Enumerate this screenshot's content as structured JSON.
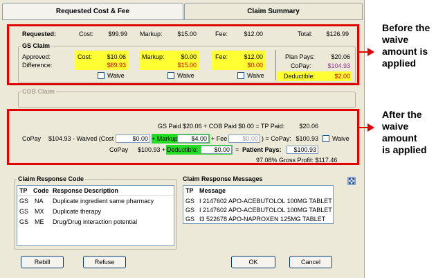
{
  "tabs": {
    "cost_fee": "Requested Cost & Fee",
    "claim_summary": "Claim Summary"
  },
  "requested": {
    "label": "Requested:",
    "cost_label": "Cost:",
    "cost": "$99.99",
    "markup_label": "Markup:",
    "markup": "$15.00",
    "fee_label": "Fee:",
    "fee": "$12.00",
    "total_label": "Total:",
    "total": "$126.99"
  },
  "gs_claim": {
    "title": "GS  Claim",
    "approved_label": "Approved:",
    "difference_label": "Difference:",
    "cost_label": "Cost:",
    "cost_approved": "$10.06",
    "cost_diff": "$89.93",
    "markup_label": "Markup:",
    "markup_approved": "$0.00",
    "markup_diff": "$15.00",
    "fee_label": "Fee:",
    "fee_approved": "$12.00",
    "fee_diff": "$0.00",
    "waive_label": "Waive",
    "plan_pays_label": "Plan Pays:",
    "plan_pays": "$20.06",
    "copay_label": "CoPay:",
    "copay": "$104.93",
    "deductible_label": "Deductible:",
    "deductible": "$2.00"
  },
  "cob_claim": {
    "title": "COB Claim"
  },
  "summary": {
    "line1": "GS Paid $20.06 + COB Paid $0.00  =  TP Paid:",
    "tp_paid": "$20.06",
    "copay_label": "CoPay",
    "copay_waived_text": "$104.93 - Waived (Cost",
    "cost_waived": "$0.00",
    "plus_markup": "+ Markup",
    "markup_waived": "$4.00",
    "plus_fee": "+ Fee",
    "fee_waived": "$0.00",
    "eq_copay": ") = CoPay:",
    "copay_after": "$100.93",
    "waive_label": "Waive",
    "copay2_label": "CoPay",
    "copay2_text": "$100.93 +",
    "deductible_label": "Deductible:",
    "deductible_value": "$0.00",
    "eq": "=",
    "patient_pays_label": "Patient Pays:",
    "patient_pays": "$100.93",
    "gross_profit": "97.08% Gross Profit: $117.46"
  },
  "response_code": {
    "title": "Claim Response Code",
    "columns": [
      "TP",
      "Code",
      "Response Description"
    ],
    "rows": [
      [
        "GS",
        "NA",
        "Duplicate ingredient same pharmacy"
      ],
      [
        "GS",
        "MX",
        "Duplicate therapy"
      ],
      [
        "GS",
        "ME",
        "Drug/Drug interaction potential"
      ]
    ]
  },
  "response_messages": {
    "title": "Claim Response Messages",
    "columns": [
      "TP",
      "Message"
    ],
    "rows": [
      [
        "GS",
        "I 2147602 APO-ACEBUTOLOL 100MG TABLET"
      ],
      [
        "GS",
        "I 2147602 APO-ACEBUTOLOL 100MG TABLET"
      ],
      [
        "GS",
        "I3 522678 APO-NAPROXEN 125MG TABLET"
      ]
    ]
  },
  "buttons": {
    "rebill": "Rebill",
    "refuse": "Refuse",
    "ok": "OK",
    "cancel": "Cancel"
  },
  "annotations": {
    "before": [
      "Before the",
      "waive",
      "amount is",
      "applied"
    ],
    "after": [
      "After the",
      "waive",
      "amount",
      "is applied"
    ]
  },
  "colors": {
    "highlight_yellow": "#ffff33",
    "highlight_green": "#22dd22",
    "annotation_red": "#e00000"
  }
}
